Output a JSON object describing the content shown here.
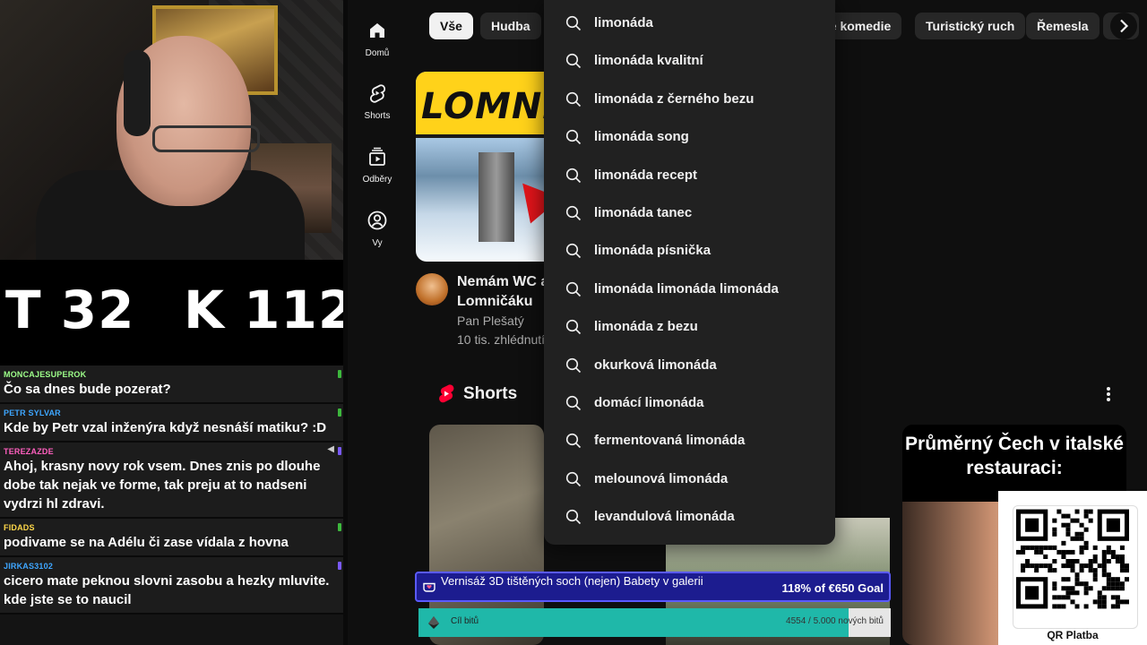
{
  "stream": {
    "stat_t": "T 32",
    "stat_k": "K 112"
  },
  "chat": [
    {
      "user": "MONCAJESUPEROK",
      "color": "#9eff8a",
      "text": "Čo sa dnes bude pozerat?",
      "badge": "#3db83d"
    },
    {
      "user": "PETR SYLVAR",
      "color": "#3ea6ff",
      "text": "Kde by Petr vzal inženýra když nesnáší matiku? :D",
      "badge": "#3db83d"
    },
    {
      "user": "TEREZAZDE",
      "color": "#ff5fbf",
      "text": "Ahoj, krasny novy rok vsem. Dnes znis po dlouhe dobe tak nejak ve forme, tak preju at to nadseni vydrzi hl zdravi.",
      "badge": "#7a5aff"
    },
    {
      "user": "FIDADS",
      "color": "#ffd84a",
      "text": "podivame se na Adélu či zase vídala z hovna",
      "badge": "#3db83d"
    },
    {
      "user": "JIRKAS3102",
      "color": "#3ea6ff",
      "text": "cicero mate peknou slovni zasobu a hezky mluvite. kde jste se to naucil",
      "badge": "#7a5aff"
    }
  ],
  "rail": {
    "home": "Domů",
    "shorts": "Shorts",
    "subscriptions": "Odběry",
    "you": "Vy"
  },
  "chips": {
    "all": "Vše",
    "music": "Hudba",
    "comedy": "vé komedie",
    "tourism": "Turistický ruch",
    "crafts": "Řemesla"
  },
  "video": {
    "thumb_text": "LOMNIC",
    "title_line1": "Nemám WC ar",
    "title_line2": "Lomničáku",
    "channel": "Pan Plešatý",
    "views": "10 tis. zhlédnutí"
  },
  "shorts": {
    "heading": "Shorts",
    "card3_text": "Průměrný Čech v italské restauraci:"
  },
  "suggestions": [
    "limonáda",
    "limonáda kvalitní",
    "limonáda z černého bezu",
    "limonáda song",
    "limonáda recept",
    "limonáda tanec",
    "limonáda písnička",
    "limonáda limonáda limonáda",
    "limonáda z bezu",
    "okurková limonáda",
    "domácí limonáda",
    "fermentovaná limonáda",
    "melounová limonáda",
    "levandulová limonáda"
  ],
  "goal": {
    "text": "Vernisáž 3D tištěných soch (nejen) Babety v galerii",
    "percent": "118% of €650 Goal"
  },
  "bits": {
    "label": "Cíl bitů",
    "count": "4554 / 5.000 nových bitů",
    "progress": 0.9108
  },
  "qr": {
    "label": "QR Platba"
  }
}
